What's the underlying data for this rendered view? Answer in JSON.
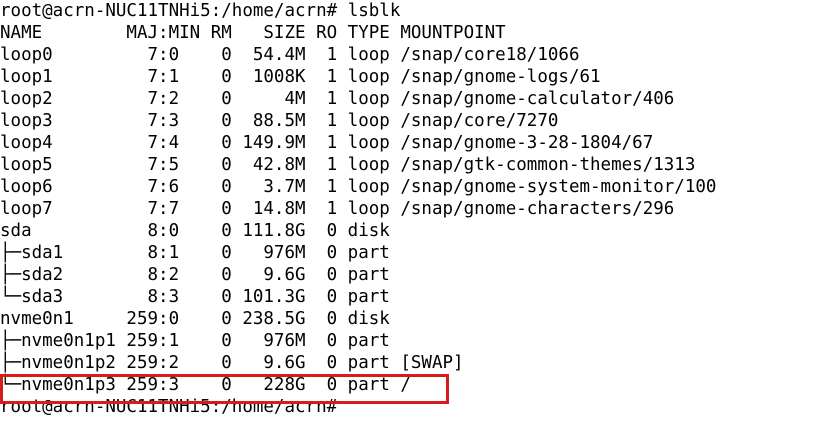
{
  "terminal": {
    "prompt": "root@acrn-NUC11TNHi5:/home/acrn#",
    "command": "lsblk",
    "header": "NAME        MAJ:MIN RM   SIZE RO TYPE MOUNTPOINT",
    "rows": [
      "loop0         7:0    0  54.4M  1 loop /snap/core18/1066",
      "loop1         7:1    0  1008K  1 loop /snap/gnome-logs/61",
      "loop2         7:2    0     4M  1 loop /snap/gnome-calculator/406",
      "loop3         7:3    0  88.5M  1 loop /snap/core/7270",
      "loop4         7:4    0 149.9M  1 loop /snap/gnome-3-28-1804/67",
      "loop5         7:5    0  42.8M  1 loop /snap/gtk-common-themes/1313",
      "loop6         7:6    0   3.7M  1 loop /snap/gnome-system-monitor/100",
      "loop7         7:7    0  14.8M  1 loop /snap/gnome-characters/296",
      "sda           8:0    0 111.8G  0 disk",
      "├─sda1        8:1    0   976M  0 part",
      "├─sda2        8:2    0   9.6G  0 part",
      "└─sda3        8:3    0 101.3G  0 part",
      "nvme0n1     259:0    0 238.5G  0 disk",
      "├─nvme0n1p1 259:1    0   976M  0 part",
      "├─nvme0n1p2 259:2    0   9.6G  0 part [SWAP]",
      "└─nvme0n1p3 259:3    0   228G  0 part /"
    ],
    "final_prompt": "root@acrn-NUC11TNHi5:/home/acrn#"
  },
  "highlight_color": "#d71c1c"
}
